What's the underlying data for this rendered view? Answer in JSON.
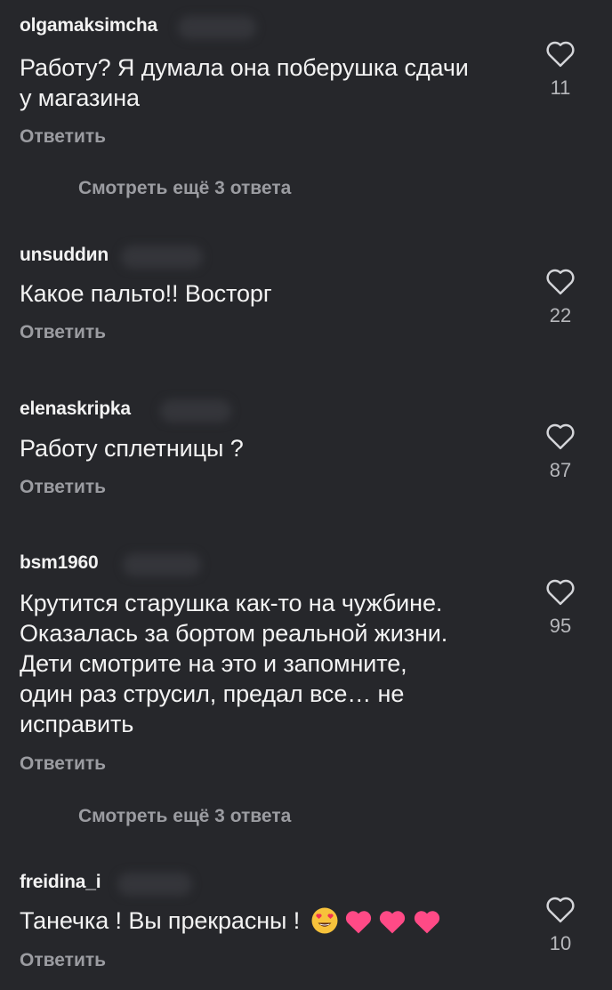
{
  "comments": [
    {
      "username": "olgamaksimcha",
      "text_lines": [
        "Работу? Я думала она поберушка сдачи",
        "у магазина"
      ],
      "reply_label": "Ответить",
      "likes": "11"
    },
    {
      "username": "unsuddиn",
      "text_lines": [
        "Какое пальто!! Восторг"
      ],
      "reply_label": "Ответить",
      "likes": "22"
    },
    {
      "username": "elenaskripka",
      "text_lines": [
        "Работу сплетницы ?"
      ],
      "reply_label": "Ответить",
      "likes": "87"
    },
    {
      "username": "bsm1960",
      "text_lines": [
        "Крутится старушка как-то на чужбине.",
        "Оказалась за бортом реальной жизни.",
        "Дети смотрите на это и запомните,",
        "один раз струсил, предал все… не",
        "исправить"
      ],
      "reply_label": "Ответить",
      "likes": "95"
    },
    {
      "username": "freidina_i",
      "text_lines": [
        "Танечка ! Вы прекрасны !"
      ],
      "reply_label": "Ответить",
      "likes": "10",
      "emoji": [
        "heart-eyes-emoji",
        "pink-heart-emoji",
        "pink-heart-emoji",
        "pink-heart-emoji"
      ]
    }
  ],
  "view_more": [
    "Смотреть ещё 3 ответа",
    "Смотреть ещё 3 ответа"
  ],
  "colors": {
    "background": "#26272b",
    "text": "#f3f3f3",
    "secondary": "#9b9ca1",
    "heart_emoji": "#ff4a86"
  },
  "icons": {
    "like": "heart-outline-icon"
  }
}
